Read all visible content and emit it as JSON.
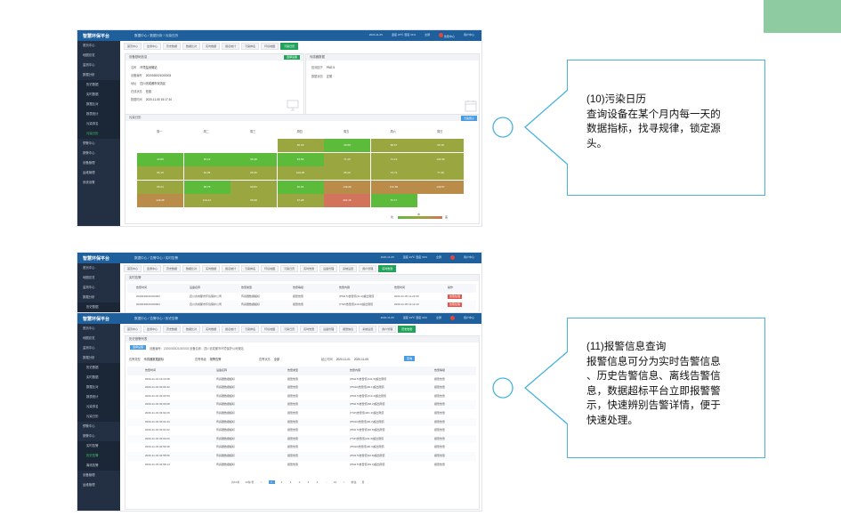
{
  "calendar_app": {
    "brand": "智慧环保平台",
    "breadcrumb": "数据中心 / 数据分析 / 污染日历",
    "top_info": [
      "2020-11-05",
      "温度 23℃ 湿度 31%",
      "全屏",
      "告警中心",
      "用户中心"
    ],
    "sidebar": [
      "首页中心",
      "地图总览",
      "监测中心",
      "数据分析",
      "历史数据",
      "实时数据",
      "数据比对",
      "报表统计",
      "污染排名",
      "污染日历",
      "预警中心",
      "报警中心",
      "设备管理",
      "运维管理",
      "系统设置"
    ],
    "active_sidebar": "污染日历",
    "tabs": [
      "首页中心",
      "监测中心",
      "历史数据",
      "数据比对",
      "实时数据",
      "报表统计",
      "污染排名",
      "环境地图",
      "污染日历"
    ],
    "info_panel_title": "设备基础信息",
    "info_button": "选择设备",
    "info_fields": [
      {
        "label": "名称",
        "value": "环境监测微站"
      },
      {
        "label": "设备编号",
        "value": "2020030021000003"
      },
      {
        "label": "地址",
        "value": "四川省成都市双流区"
      },
      {
        "label": "在线状态",
        "value": "在线"
      },
      {
        "label": "数据时间",
        "value": "2020-11-05 16:17:10"
      }
    ],
    "sensor_panel_title": "传感器数据",
    "sensor_fields": [
      {
        "label": "检测因子",
        "value": "PM2.5"
      },
      {
        "label": "数据状态",
        "value": "正常"
      }
    ],
    "calendar_title": "污染日历",
    "query_button": "污染因子",
    "weekdays": [
      "周一",
      "周二",
      "周三",
      "周四",
      "周五",
      "周六",
      "周日"
    ],
    "legend": [
      "优",
      "中",
      "差"
    ],
    "rows": [
      [
        "",
        "",
        "",
        "60.18",
        "33.69",
        "68.67",
        "69.18"
      ],
      [
        "43.89",
        "33.23",
        "56.48",
        "43.56",
        "71.26",
        "71.13",
        "102.36"
      ],
      [
        "65.15",
        "64.35",
        "65.35",
        "103.28",
        "65.26",
        "73.72",
        "77.48"
      ],
      [
        "65.24",
        "48.75",
        "69.83",
        "40.04",
        "149.29",
        "131.59",
        "129.57"
      ],
      [
        "123.28",
        "103.14",
        "65.68",
        "67.28",
        "264.15",
        "57.17",
        ""
      ]
    ]
  },
  "alarm_app": {
    "brand": "智慧环保平台",
    "breadcrumb_bg": "数据中心 / 告警中心 / 实时告警",
    "breadcrumb": "数据中心 / 告警中心 / 历史告警",
    "sidebar": [
      "首页中心",
      "地图总览",
      "监测中心",
      "数据分析",
      "历史数据",
      "实时数据",
      "数据比对",
      "报表统计",
      "污染排名",
      "污染日历",
      "预警中心",
      "报警中心",
      "实时告警",
      "历史告警",
      "离线告警",
      "设备管理",
      "运维管理"
    ],
    "active_sidebar": "历史告警",
    "tabs_bg": [
      "首页中心",
      "监测中心",
      "历史数据",
      "数据比对",
      "实时数据",
      "报表统计",
      "污染排名",
      "环境地图",
      "污染日历",
      "实时告警",
      "设备管理",
      "系统设置",
      "用户管理",
      "实时告警"
    ],
    "bg_table_title": "实时告警",
    "bg_headers": [
      "告警时间",
      "设备名称",
      "告警类型",
      "告警等级",
      "告警内容",
      "告警时间",
      "操作"
    ],
    "bg_rows": [
      [
        "2020030021000003",
        "四川省成都市环境保护公司",
        "传感器数据超标",
        "报警告警",
        "(PM2.5)告警值(11.2)超出限值",
        "2020-11-05 14:23:30",
        "告警处理"
      ],
      [
        "2020030021000004",
        "四川省成都市环境保护公司",
        "传感器数据超标",
        "报警告警",
        "(TSP)告警值(119.2)超出限值",
        "2020-11-05 14:12:10",
        "告警处理"
      ]
    ],
    "tabs": [
      "首页中心",
      "监测中心",
      "历史数据",
      "数据比对",
      "实时数据",
      "报表统计",
      "污染排名",
      "环境地图",
      "污染日历",
      "实时告警",
      "设备管理",
      "报警信息",
      "系统设置",
      "用户管理",
      "历史告警"
    ],
    "filter_title": "历史报警列表",
    "device_button": "选择设备",
    "device_info": "设备编号：2020030021000003  设备名称：四川省成都市环境保护公司微站",
    "filter_labels": [
      "告警类型",
      "告警等级",
      "告警状态",
      "起止时间"
    ],
    "filter_values": [
      "传感器数据超标",
      "报警告警",
      "全部",
      "2020-11-01",
      "2020-11-05"
    ],
    "search_button": "查询",
    "headers": [
      "告警时间",
      "设备名称",
      "告警类型",
      "告警内容",
      "告警等级"
    ],
    "rows": [
      [
        "2020-11-04 19:10:38",
        "传感器数据超标",
        "报警告警",
        "(PM2.5)告警值(121.5)超出限值",
        "报警告警"
      ],
      [
        "2020-11-03 03:04:32",
        "传感器数据超标",
        "报警告警",
        "(PM10)告警值(90.1)超出限值",
        "报警告警"
      ],
      [
        "2020-11-03 03:03:50",
        "传感器数据超标",
        "报警告警",
        "(PM2.5)告警值(113.4)超出限值",
        "报警告警"
      ],
      [
        "2020-11-03 03:03:08",
        "传感器数据超标",
        "报警告警",
        "(PM2.5)告警值(98.2)超出限值",
        "报警告警"
      ],
      [
        "2020-11-03 03:02:26",
        "传感器数据超标",
        "报警告警",
        "(TSP)告警值(201.3)超出限值",
        "报警告警"
      ],
      [
        "2020-11-03 03:01:44",
        "传感器数据超标",
        "报警告警",
        "(PM10)告警值(90.7)超出限值",
        "报警告警"
      ],
      [
        "2020-11-03 03:01:02",
        "传感器数据超标",
        "报警告警",
        "(PM2.5)告警值(90.9)超出限值",
        "报警告警"
      ],
      [
        "2020-11-03 03:00:20",
        "传感器数据超标",
        "报警告警",
        "(TSP)告警值(211.6)超出限值",
        "报警告警"
      ],
      [
        "2020-11-03 02:59:38",
        "传感器数据超标",
        "报警告警",
        "(PM10)告警值(90.3)超出限值",
        "报警告警"
      ],
      [
        "2020-11-03 02:58:56",
        "传感器数据超标",
        "报警告警",
        "(PM2.5)告警值(92.8)超出限值",
        "报警告警"
      ],
      [
        "2020-11-03 02:58:14",
        "传感器数据超标",
        "报警告警",
        "(PM2.5)告警值(99.3)超出限值",
        "报警告警"
      ]
    ],
    "pager": {
      "total": "共10条",
      "size": "10条/页",
      "pages": [
        "1",
        "2",
        "3",
        "4",
        "5",
        "6",
        "...",
        "10"
      ],
      "goto": "前往",
      "page_unit": "页"
    }
  },
  "callouts": {
    "calendar": {
      "title": "(10)污染日历",
      "lines": [
        "查询设备在某个月内每一天的",
        "数据指标，找寻规律，锁定源",
        "头。"
      ]
    },
    "alarm": {
      "title": "(11)报警信息查询",
      "lines": [
        "报警信息可分为实时告警信息",
        "、历史告警信息、离线告警信",
        "息，数据超标平台立即报警警",
        "示，快速辨别告警详情，便于",
        "快速处理。"
      ]
    }
  },
  "colors": {
    "accent_green": "#21a45a",
    "callout_border": "#49b3dc",
    "corner_green": "#8fcba0",
    "cell_good": "#5dbb3c",
    "cell_moderate": "#9aa63f",
    "cell_bad": "#d2735b"
  }
}
